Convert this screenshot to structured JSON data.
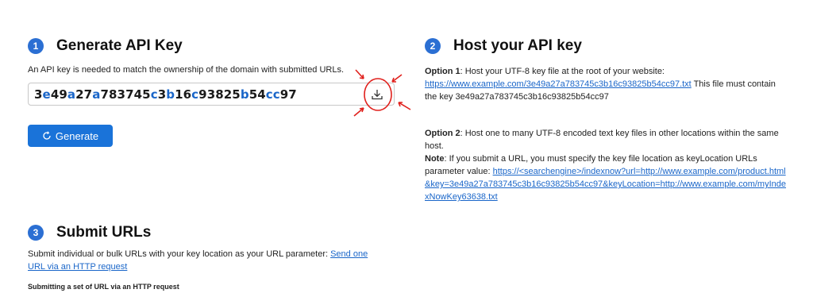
{
  "step1": {
    "number": "1",
    "title": "Generate API Key",
    "description": "An API key is needed to match the ownership of the domain with submitted URLs.",
    "api_key_segments": [
      {
        "t": "3",
        "c": "#1a1a1a"
      },
      {
        "t": "e",
        "c": "#1a66c9"
      },
      {
        "t": "49",
        "c": "#1a1a1a"
      },
      {
        "t": "a",
        "c": "#1a66c9"
      },
      {
        "t": "27",
        "c": "#1a1a1a"
      },
      {
        "t": "a",
        "c": "#1a66c9"
      },
      {
        "t": "783745",
        "c": "#1a1a1a"
      },
      {
        "t": "c",
        "c": "#1a66c9"
      },
      {
        "t": "3",
        "c": "#1a1a1a"
      },
      {
        "t": "b",
        "c": "#1a66c9"
      },
      {
        "t": "16",
        "c": "#1a1a1a"
      },
      {
        "t": "c",
        "c": "#1a66c9"
      },
      {
        "t": "93825",
        "c": "#1a1a1a"
      },
      {
        "t": "b",
        "c": "#1a66c9"
      },
      {
        "t": "54",
        "c": "#1a1a1a"
      },
      {
        "t": "cc",
        "c": "#1a66c9"
      },
      {
        "t": "97",
        "c": "#1a1a1a"
      }
    ],
    "download_icon": "download-icon",
    "generate_label": "Generate",
    "generate_icon": "refresh-icon"
  },
  "step2": {
    "number": "2",
    "title": "Host your API key",
    "opt1_label": "Option 1",
    "opt1_text": ": Host your UTF-8 key file at the root of your website:",
    "opt1_link": "https://www.example.com/3e49a27a783745c3b16c93825b54cc97.txt",
    "opt1_tail": " This file must contain the key 3e49a27a783745c3b16c93825b54cc97",
    "opt2_label": "Option 2",
    "opt2_text": ": Host one to many UTF-8 encoded text key files in other locations within the same host.",
    "note_label": "Note",
    "note_text": ": If you submit a URL, you must specify the key file location as keyLocation URLs parameter value: ",
    "note_link": "https://<searchengine>/indexnow?url=http://www.example.com/product.html&key=3e49a27a783745c3b16c93825b54cc97&keyLocation=http://www.example.com/myIndexNowKey63638.txt"
  },
  "step3": {
    "number": "3",
    "title": "Submit URLs",
    "description": "Submit individual or bulk URLs with your key location as your URL parameter: ",
    "desc_link": "Send one URL via an HTTP request",
    "subheading": "Submitting a set of URL via an HTTP request"
  },
  "colors": {
    "accent": "#1a73d9",
    "badge": "#2b6fd3",
    "annotation": "#e0201c",
    "link": "#1a66c9"
  }
}
